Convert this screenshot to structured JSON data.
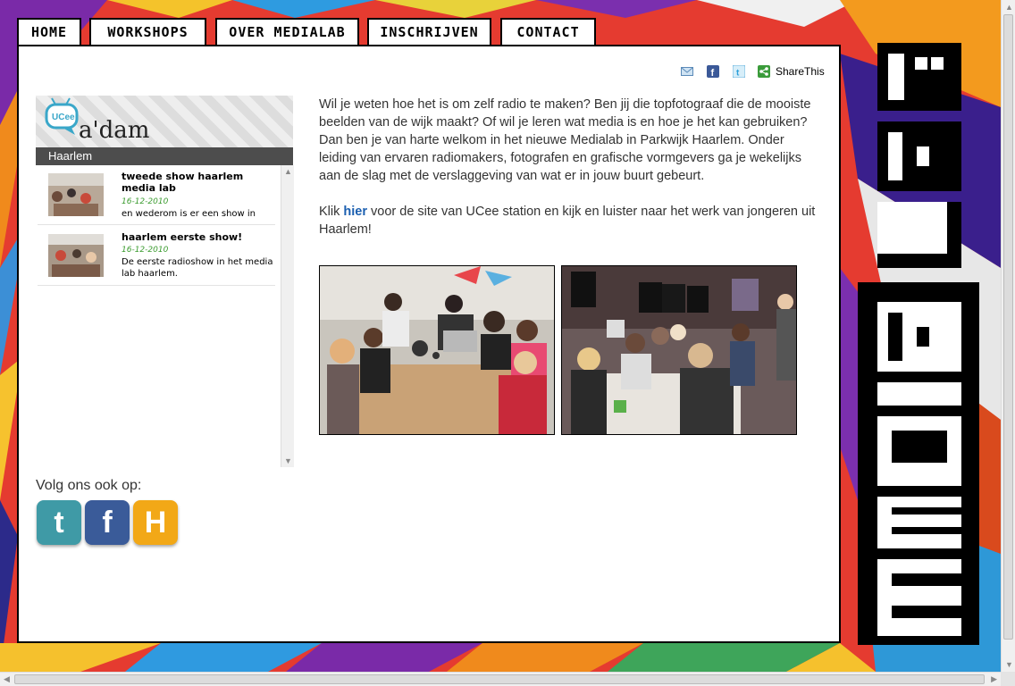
{
  "nav": {
    "tabs": [
      {
        "label": "HOME",
        "active": true
      },
      {
        "label": "WORKSHOPS",
        "active": false
      },
      {
        "label": "OVER MEDIALAB",
        "active": false
      },
      {
        "label": "INSCHRIJVEN",
        "active": false
      },
      {
        "label": "CONTACT",
        "active": false
      }
    ]
  },
  "share": {
    "icons": [
      "email-icon",
      "facebook-icon",
      "twitter-icon"
    ],
    "label": "ShareThis"
  },
  "widget": {
    "logo_badge": "UCee",
    "logo_text": "a'dam",
    "heading": "Haarlem",
    "items": [
      {
        "title": "tweede show haarlem media lab",
        "date": "16-12-2010",
        "snippet": "en wederom is er een show in"
      },
      {
        "title": "haarlem eerste show!",
        "date": "16-12-2010",
        "snippet": "De eerste radioshow in het media lab haarlem."
      }
    ]
  },
  "follow": {
    "label": "Volg ons ook op:",
    "buttons": [
      {
        "name": "twitter",
        "glyph": "t",
        "color": "#3f9aa6"
      },
      {
        "name": "facebook",
        "glyph": "f",
        "color": "#3a5b99"
      },
      {
        "name": "hyves",
        "glyph": "H",
        "color": "#f2a817"
      }
    ]
  },
  "content": {
    "intro": "Wil je weten hoe het is om zelf radio te maken? Ben jij die topfotograaf die de mooiste beelden van de wijk maakt? Of wil je leren wat media is en hoe je het kan gebruiken? Dan ben je van harte welkom in het nieuwe Medialab in Parkwijk Haarlem. Onder leiding van ervaren radiomakers, fotografen en grafische vormgevers ga je wekelijks aan de slag met de verslaggeving van wat er in jouw buurt gebeurt.",
    "link_prefix": "Klik ",
    "link_text": "hier",
    "link_suffix": " voor de site van UCee station en kijk en luister naar het werk van jongeren uit Haarlem!"
  },
  "brand": {
    "logo_text": "MEDIALAB"
  }
}
